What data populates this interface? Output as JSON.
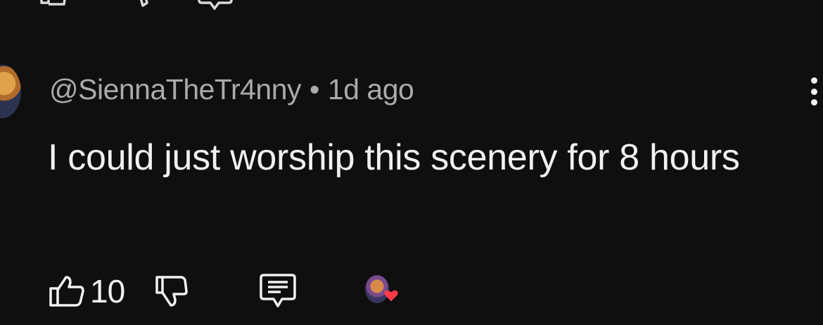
{
  "previous_comment": {
    "actions": [
      "like-icon",
      "dislike-icon",
      "reply-icon"
    ]
  },
  "comment": {
    "author": "@SiennaTheTr4nny",
    "separator": "•",
    "timestamp": "1d ago",
    "text": "I could just worship this scenery for 8 hours",
    "like_count": "10",
    "icons": {
      "like": "thumbs-up-icon",
      "dislike": "thumbs-down-icon",
      "reply": "reply-comment-icon",
      "more": "more-vert-icon",
      "creator_heart": "creator-heart-icon"
    },
    "colors": {
      "background": "#0f0f0f",
      "text": "#f1f1f1",
      "meta": "#aaaaaa",
      "heart": "#ff3b4a"
    }
  }
}
